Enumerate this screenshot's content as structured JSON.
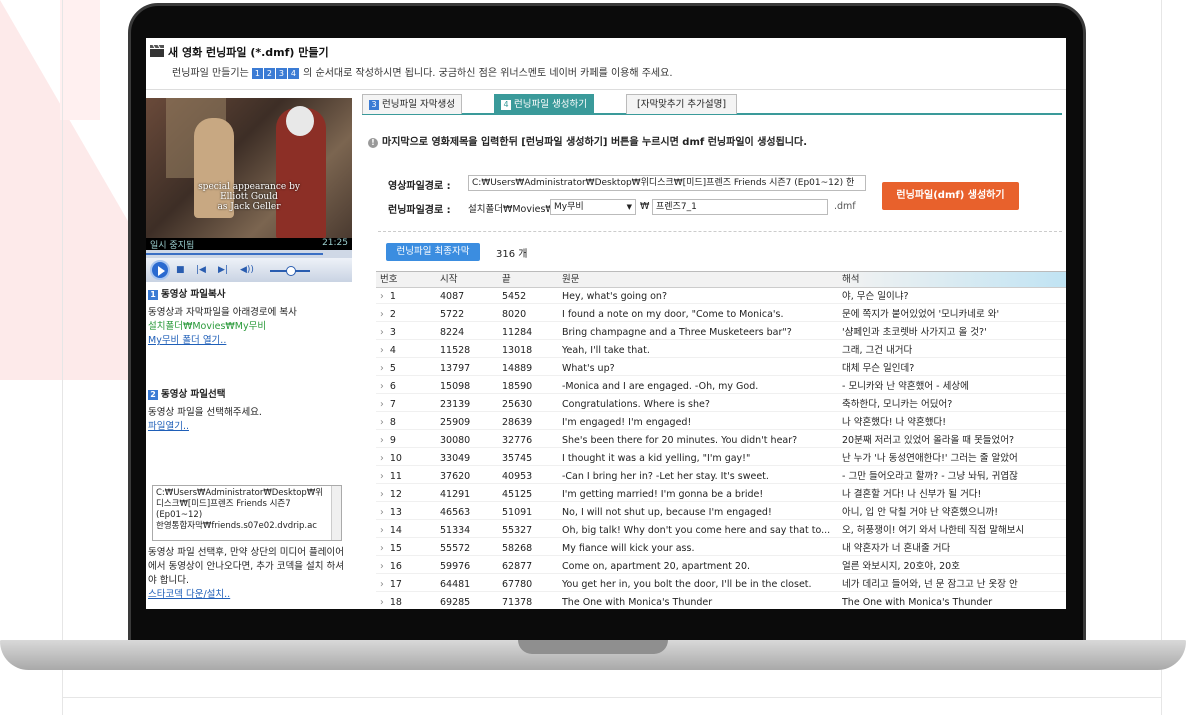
{
  "window": {
    "title": "새 영화 런닝파일 (*.dmf) 만들기",
    "subtitle_before": "런닝파일 만들기는",
    "subtitle_steps": [
      "1",
      "2",
      "3",
      "4"
    ],
    "subtitle_after": "의 순서대로 작성하시면 됩니다. 궁금하신 점은 위너스멘토 네이버 카페를 이용해 주세요."
  },
  "player": {
    "caption_lines": [
      "special appearance by",
      "Elliott Gould",
      "as Jack Geller"
    ],
    "status_left": "일시 중지됨",
    "status_right": "21:25",
    "seek_progress": 0.86,
    "controls": {
      "stop": "■",
      "prev": "|◀",
      "next": "▶|",
      "volume": "◀))"
    }
  },
  "step1": {
    "number": "1",
    "title": "동영상 파일복사",
    "desc": "동영상과 자막파일을 아래경로에 복사",
    "path": "설치폴더₩Movies₩My무비",
    "link": "My무비 폴더 열기.."
  },
  "step2": {
    "number": "2",
    "title": "동영상 파일선택",
    "desc": "동영상 파일을 선택해주세요.",
    "link": "파일열기..",
    "file_lines": [
      "C:₩Users₩Administrator₩Desktop₩위",
      "디스크₩[미드]프렌즈 Friends 시즌7",
      "(Ep01~12)",
      "한영통합자막₩friends.s07e02.dvdrip.ac"
    ],
    "help": "동영상 파일 선택후, 만약 상단의 미디어 플레이어에서 동영상이 안나오다면, 추가 코덱을 설치 하셔야 합니다.",
    "codec_link": "스타코덱 다운/설치.."
  },
  "tabs": [
    {
      "num": "3",
      "label": "런닝파일 자막생성",
      "active": false
    },
    {
      "num": "4",
      "label": "런닝파일 생성하기",
      "active": true
    },
    {
      "num": "",
      "label": "[자막맞추기 추가설명]",
      "active": false
    }
  ],
  "notice": {
    "icon": "!",
    "text": "마지막으로 영화제목을 입력한뒤 [런닝파일 생성하기] 버튼을 누르시면 dmf 런닝파일이 생성됩니다."
  },
  "form": {
    "video_label": "영상파일경로 :",
    "video_path": "C:₩Users₩Administrator₩Desktop₩위디스크₩[미드]프렌즈 Friends 시즌7 (Ep01~12) 한",
    "running_label": "런닝파일경로 :",
    "running_prefix": "설치폴더₩Movies₩",
    "folder_select": "My무비",
    "folder_sep": "₩",
    "title_value": "프렌즈7_1",
    "ext": ".dmf",
    "create_button": "런닝파일(dmf) 생성하기"
  },
  "subtitles": {
    "final_button": "런닝파일 최종자막",
    "count": "316 개",
    "headers": [
      "번호",
      "시작",
      "끝",
      "원문",
      "해석"
    ],
    "rows": [
      [
        "1",
        "4087",
        "5452",
        "Hey, what's going on?",
        "야, 무슨 일이냐?"
      ],
      [
        "2",
        "5722",
        "8020",
        "I found a note on my door, \"Come to Monica's.",
        "문에 쪽지가 붙어있었어 '모니카네로 와'"
      ],
      [
        "3",
        "8224",
        "11284",
        "Bring champagne and a Three Musketeers bar\"?",
        "'샴페인과 초코렛바 사가지고 올 것?'"
      ],
      [
        "4",
        "11528",
        "13018",
        "Yeah, I'll take that.",
        "그래, 그건 내거다"
      ],
      [
        "5",
        "13797",
        "14889",
        "What's up?",
        "대체 무슨 일인데?"
      ],
      [
        "6",
        "15098",
        "18590",
        "-Monica and I are engaged. -Oh, my God.",
        "- 모니카와 난 약혼했어 - 세상에"
      ],
      [
        "7",
        "23139",
        "25630",
        "Congratulations. Where is she?",
        "축하한다, 모니카는 어딨어?"
      ],
      [
        "8",
        "25909",
        "28639",
        "I'm engaged! I'm engaged!",
        "나 약혼했다! 나 약혼했다!"
      ],
      [
        "9",
        "30080",
        "32776",
        "She's been there for 20 minutes. You didn't hear?",
        "20분째 저러고 있었어 올라올 때 못들었어?"
      ],
      [
        "10",
        "33049",
        "35745",
        "I thought it was a kid yelling, \"I'm gay!\"",
        "난 누가 '나 동성연애한다!' 그러는 줄 알았어"
      ],
      [
        "11",
        "37620",
        "40953",
        "-Can I bring her in? -Let her stay. It's sweet.",
        "- 그만 들어오라고 할까? - 그냥 놔둬, 귀엽잖"
      ],
      [
        "12",
        "41291",
        "45125",
        "I'm getting married! I'm gonna be a bride!",
        "나 결혼할 거다! 나 신부가 될 거다!"
      ],
      [
        "13",
        "46563",
        "51091",
        "No, I will not shut up, because I'm engaged!",
        "아니, 입 안 닥칠 거야 난 약혼했으니까!"
      ],
      [
        "14",
        "51334",
        "55327",
        "Oh, big talk! Why don't you come here and say that to...",
        "오, 허풍쟁이! 여기 와서 나한테 직접 말해보시"
      ],
      [
        "15",
        "55572",
        "58268",
        "My fiance will kick your ass.",
        "내 약혼자가 너 혼내줄 거다"
      ],
      [
        "16",
        "59976",
        "62877",
        "Come on, apartment 20, apartment 20.",
        "얼른 와보시지, 20호야, 20호"
      ],
      [
        "17",
        "64481",
        "67780",
        "You get her in, you bolt the door, I'll be in the closet.",
        "네가 데리고 들어와, 넌 문 잠그고 난 옷장 안"
      ],
      [
        "18",
        "69285",
        "71378",
        "The One with Monica's Thunder",
        "The One with Monica's Thunder"
      ]
    ]
  },
  "colors": {
    "accent_teal": "#3a9a9a",
    "create_orange": "#e8612c",
    "step_blue": "#3b7bd4",
    "link_blue": "#1f5fb8",
    "path_green": "#2a9a3a"
  }
}
